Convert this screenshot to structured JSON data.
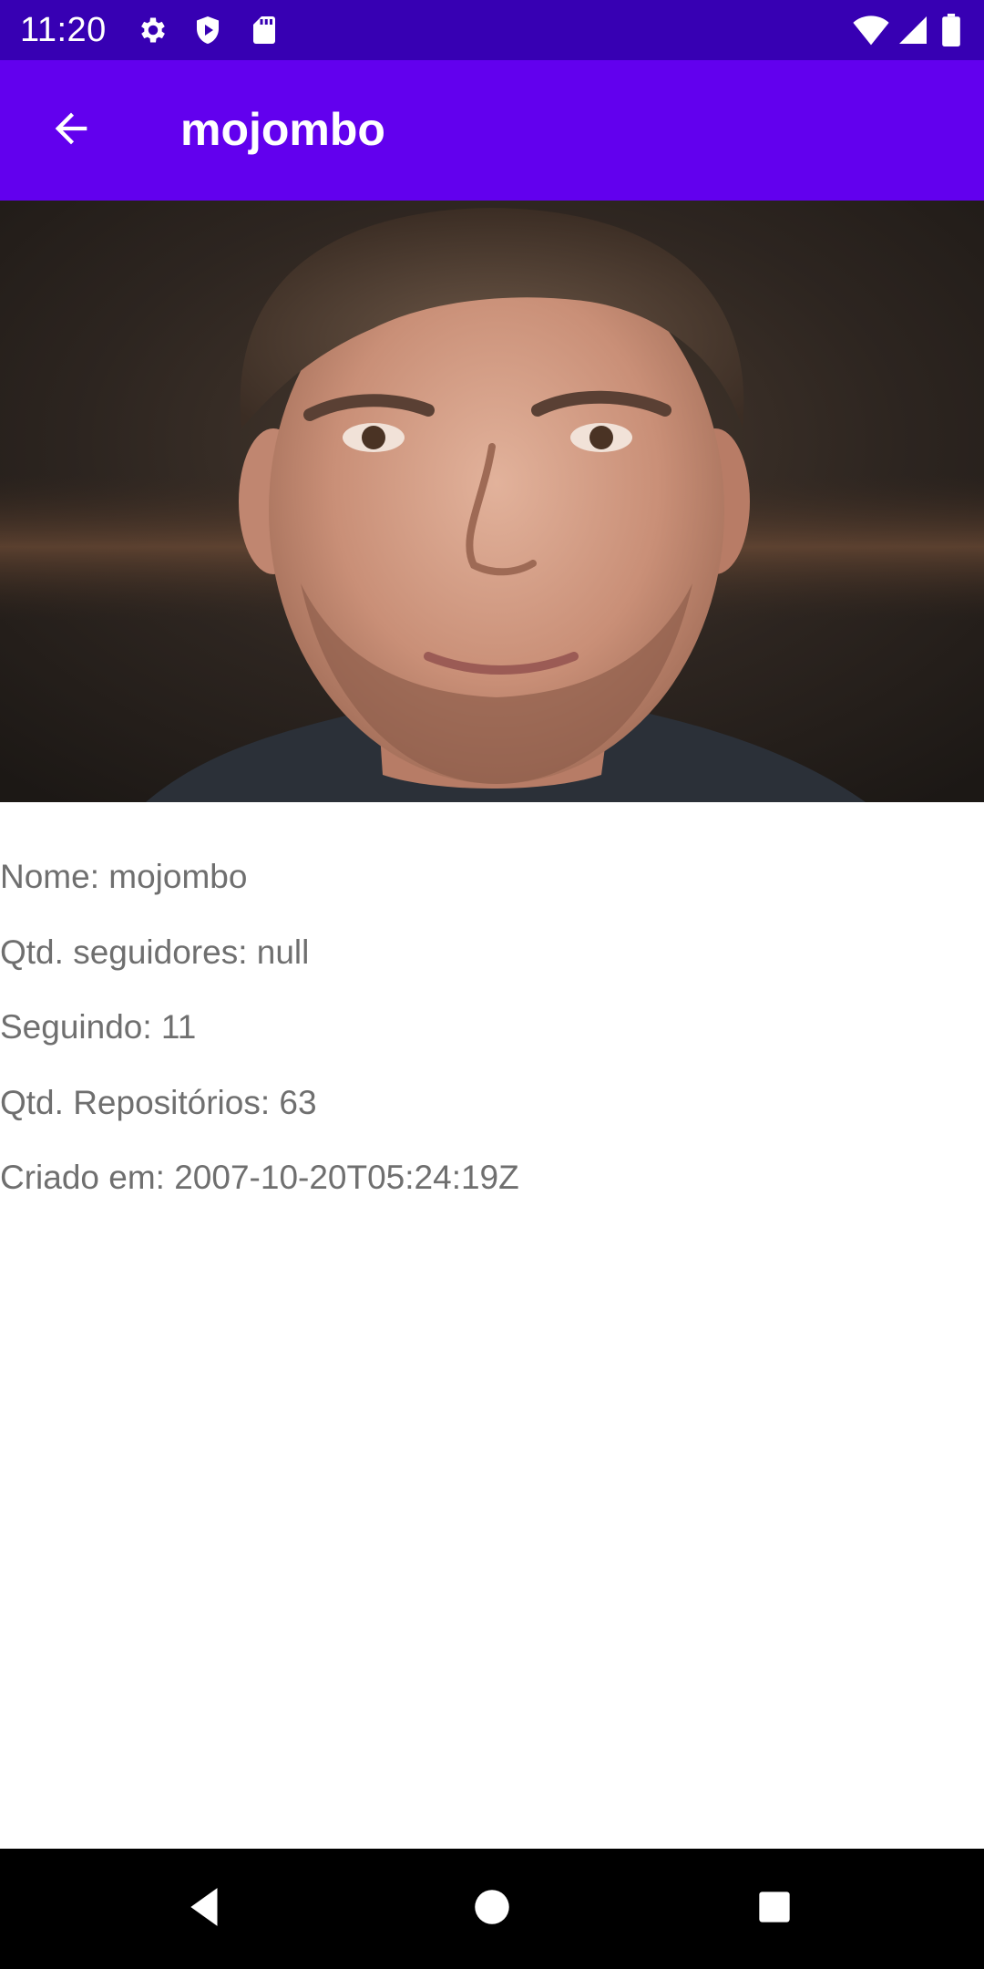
{
  "status_bar": {
    "time": "11:20",
    "left_icons": [
      "gear-icon",
      "shield-icon",
      "sd-card-icon"
    ],
    "right_icons": [
      "wifi-icon",
      "signal-icon",
      "battery-icon"
    ]
  },
  "app_bar": {
    "title": "mojombo",
    "back_icon": "arrow-back-icon",
    "color": "#6200ee"
  },
  "colors": {
    "status_bar": "#3700b3",
    "app_bar": "#6200ee",
    "info_text": "#6f6f6f",
    "nav_bar": "#000000"
  },
  "profile": {
    "avatar": "user-avatar-photo",
    "fields": [
      "Nome: mojombo",
      "Qtd. seguidores: null",
      "Seguindo: 11",
      "Qtd. Repositórios: 63",
      "Criado em: 2007-10-20T05:24:19Z"
    ]
  },
  "nav_bar": {
    "buttons": [
      "back-triangle-icon",
      "home-circle-icon",
      "recents-square-icon"
    ]
  }
}
